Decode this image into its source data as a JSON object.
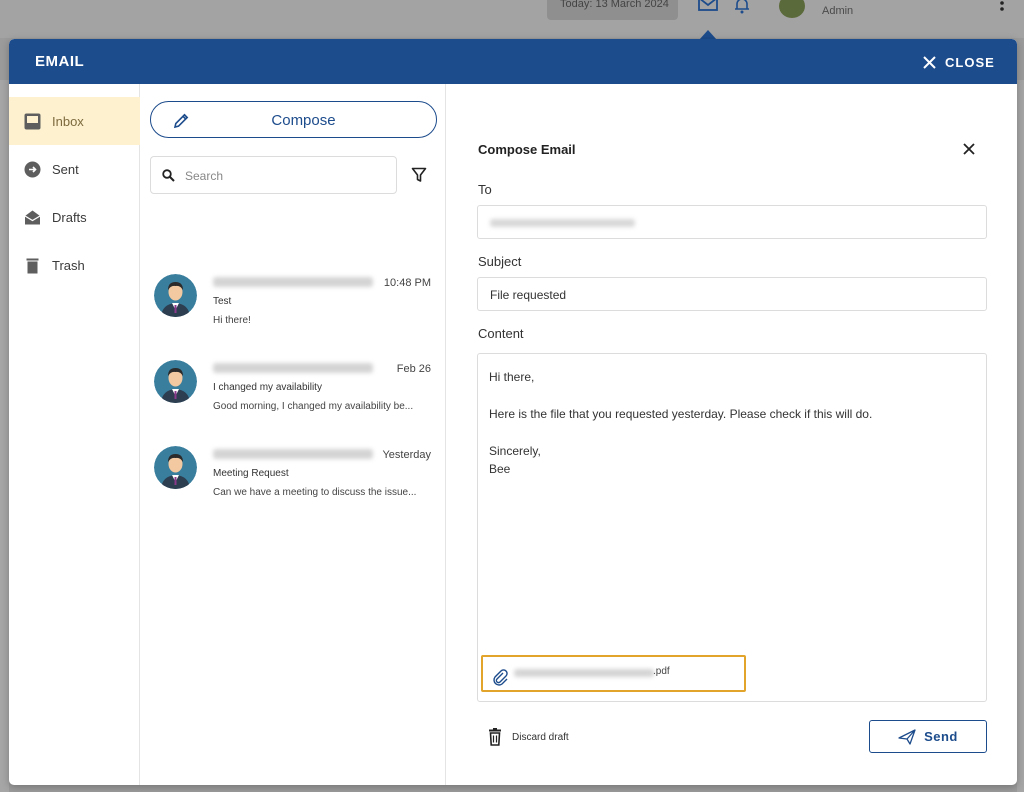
{
  "background": {
    "date_text": "Today: 13 March 2024",
    "user_role": "Admin"
  },
  "modal": {
    "title": "EMAIL",
    "close_label": "CLOSE"
  },
  "sidebar": {
    "items": [
      {
        "label": "Inbox",
        "icon": "inbox-icon",
        "active": true
      },
      {
        "label": "Sent",
        "icon": "sent-icon",
        "active": false
      },
      {
        "label": "Drafts",
        "icon": "drafts-icon",
        "active": false
      },
      {
        "label": "Trash",
        "icon": "trash-icon",
        "active": false
      }
    ]
  },
  "list": {
    "compose_label": "Compose",
    "search_placeholder": "Search",
    "messages": [
      {
        "time": "10:48 PM",
        "subject": "Test",
        "preview": "Hi there!"
      },
      {
        "time": "Feb 26",
        "subject": "I changed my availability",
        "preview": "Good morning, I changed my availability be..."
      },
      {
        "time": "Yesterday",
        "subject": "Meeting Request",
        "preview": "Can we have a meeting to discuss the issue..."
      }
    ]
  },
  "compose": {
    "title": "Compose Email",
    "to_label": "To",
    "subject_label": "Subject",
    "subject_value": "File requested",
    "content_label": "Content",
    "content_text": "Hi there,\n\nHere is the file that you requested yesterday. Please check if this will do.\n\nSincerely,\nBee",
    "attachment_ext": ".pdf",
    "discard_label": "Discard draft",
    "send_label": "Send"
  },
  "colors": {
    "header": "#1d4c8c",
    "active_sidebar": "#fdf1cf",
    "attachment_border": "#e2a42a"
  }
}
